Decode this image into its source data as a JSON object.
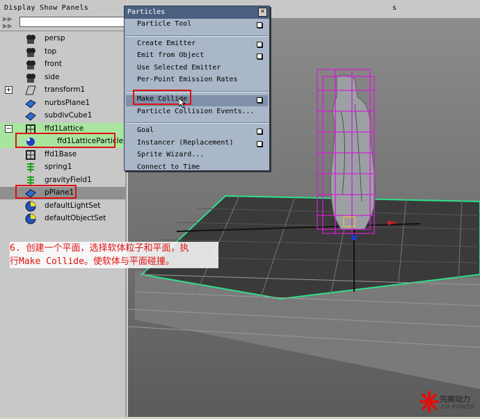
{
  "outliner": {
    "menu": [
      "Display",
      "Show",
      "Panels"
    ],
    "filter_value": "",
    "items": [
      {
        "label": "persp",
        "icon": "camera-icon",
        "expand": ""
      },
      {
        "label": "top",
        "icon": "camera-icon",
        "expand": ""
      },
      {
        "label": "front",
        "icon": "camera-icon",
        "expand": ""
      },
      {
        "label": "side",
        "icon": "camera-icon",
        "expand": ""
      },
      {
        "label": "transform1",
        "icon": "transform-icon",
        "expand": "+"
      },
      {
        "label": "nurbsPlane1",
        "icon": "nurbs-plane-icon",
        "expand": ""
      },
      {
        "label": "subdivCube1",
        "icon": "subdiv-cube-icon",
        "expand": ""
      },
      {
        "label": "ffd1Lattice",
        "icon": "lattice-icon",
        "expand": "−"
      },
      {
        "label": "ffd1LatticeParticle",
        "icon": "particle-icon",
        "expand": ""
      },
      {
        "label": "ffd1Base",
        "icon": "lattice-base-icon",
        "expand": ""
      },
      {
        "label": "spring1",
        "icon": "spring-icon",
        "expand": ""
      },
      {
        "label": "gravityField1",
        "icon": "gravity-field-icon",
        "expand": ""
      },
      {
        "label": "pPlane1",
        "icon": "poly-plane-icon",
        "expand": ""
      },
      {
        "label": "defaultLightSet",
        "icon": "set-icon",
        "expand": ""
      },
      {
        "label": "defaultObjectSet",
        "icon": "set-icon",
        "expand": ""
      }
    ]
  },
  "viewport": {
    "menu_partial": "s"
  },
  "particles_menu": {
    "title": "Particles",
    "close": "×",
    "groups": [
      [
        {
          "label": "Particle Tool",
          "option_box": true
        }
      ],
      [
        {
          "label": "Create Emitter",
          "option_box": true
        },
        {
          "label": "Emit from Object",
          "option_box": true
        },
        {
          "label": "Use Selected Emitter",
          "option_box": false
        },
        {
          "label": "Per-Point Emission Rates",
          "option_box": false
        }
      ],
      [
        {
          "label": "Make Collide",
          "option_box": true
        },
        {
          "label": "Particle Collision Events...",
          "option_box": false
        }
      ],
      [
        {
          "label": "Goal",
          "option_box": true
        },
        {
          "label": "Instancer (Replacement)",
          "option_box": true
        },
        {
          "label": "Sprite Wizard...",
          "option_box": false
        },
        {
          "label": "Connect to Time",
          "option_box": false
        }
      ]
    ]
  },
  "annotation": {
    "line1": "6. 创建一个平面，选择软体粒子和平面，执",
    "line2": "行Make Collide。使软体与平面碰撞。",
    "color": "#e01010"
  },
  "logo": {
    "name": "完美动力",
    "sub": "CG POWER"
  }
}
